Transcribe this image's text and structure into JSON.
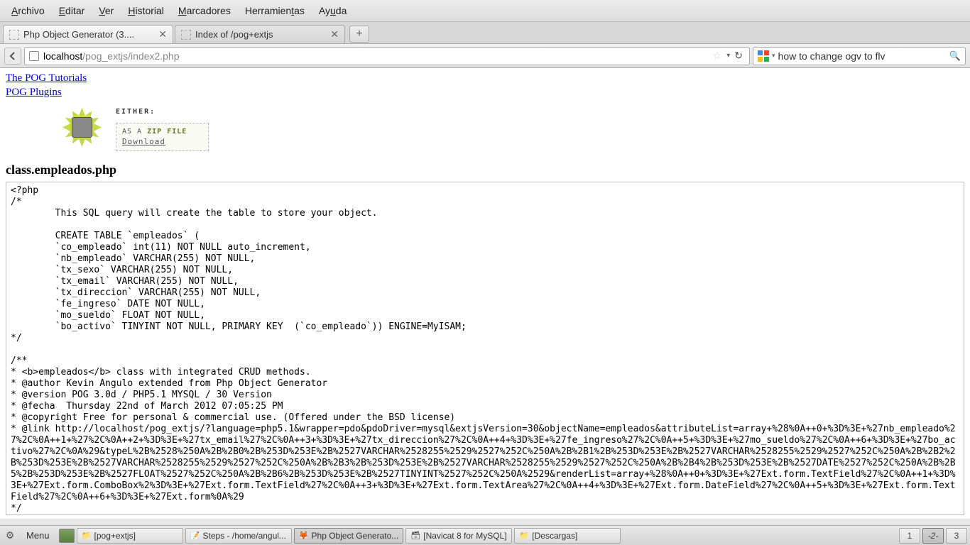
{
  "menubar": [
    "Archivo",
    "Editar",
    "Ver",
    "Historial",
    "Marcadores",
    "Herramientas",
    "Ayuda"
  ],
  "tabs": [
    {
      "title": "Php Object Generator (3....",
      "active": true
    },
    {
      "title": "Index of /pog+extjs",
      "active": false
    }
  ],
  "url": {
    "domain": "localhost",
    "path": "/pog_extjs/index2.php"
  },
  "search": {
    "query": "how to change ogv to flv"
  },
  "links": [
    "The POG Tutorials",
    "POG Plugins"
  ],
  "either": {
    "label": "EITHER:",
    "zip_prefix": "AS A ",
    "zip_suffix": "ZIP FILE",
    "download": "Download"
  },
  "class_title": "class.empleados.php",
  "code": "<?php\n/*\n\tThis SQL query will create the table to store your object.\n\n\tCREATE TABLE `empleados` (\n\t`co_empleado` int(11) NOT NULL auto_increment,\n\t`nb_empleado` VARCHAR(255) NOT NULL,\n\t`tx_sexo` VARCHAR(255) NOT NULL,\n\t`tx_email` VARCHAR(255) NOT NULL,\n\t`tx_direccion` VARCHAR(255) NOT NULL,\n\t`fe_ingreso` DATE NOT NULL,\n\t`mo_sueldo` FLOAT NOT NULL,\n\t`bo_activo` TINYINT NOT NULL, PRIMARY KEY  (`co_empleado`)) ENGINE=MyISAM;\n*/\n\n/**\n* <b>empleados</b> class with integrated CRUD methods.\n* @author Kevin Angulo extended from Php Object Generator\n* @version POG 3.0d / PHP5.1 MYSQL / 30 Version\n* @fecha  Thursday 22nd of March 2012 07:05:25 PM\n* @copyright Free for personal & commercial use. (Offered under the BSD license)\n* @link http://localhost/pog_extjs/?language=php5.1&wrapper=pdo&pdoDriver=mysql&extjsVersion=30&objectName=empleados&attributeList=array+%28%0A++0+%3D%3E+%27nb_empleado%27%2C%0A++1+%27%2C%0A++2+%3D%3E+%27tx_email%27%2C%0A++3+%3D%3E+%27tx_direccion%27%2C%0A++4+%3D%3E+%27fe_ingreso%27%2C%0A++5+%3D%3E+%27mo_sueldo%27%2C%0A++6+%3D%3E+%27bo_activo%27%2C%0A%29&typeL%2B%2528%250A%2B%2B0%2B%253D%253E%2B%2527VARCHAR%2528255%2529%2527%252C%250A%2B%2B1%2B%253D%253E%2B%2527VARCHAR%2528255%2529%2527%252C%250A%2B%2B2%2B%253D%253E%2B%2527VARCHAR%2528255%2529%2527%252C%250A%2B%2B3%2B%253D%253E%2B%2527VARCHAR%2528255%2529%2527%252C%250A%2B%2B4%2B%253D%253E%2B%2527DATE%2527%252C%250A%2B%2B5%2B%253D%253E%2B%2527FLOAT%2527%252C%250A%2B%2B6%2B%253D%253E%2B%2527TINYINT%2527%252C%250A%2529&renderList=array+%28%0A++0+%3D%3E+%27Ext.form.TextField%27%2C%0A++1+%3D%3E+%27Ext.form.ComboBox%2%3D%3E+%27Ext.form.TextField%27%2C%0A++3+%3D%3E+%27Ext.form.TextArea%27%2C%0A++4+%3D%3E+%27Ext.form.DateField%27%2C%0A++5+%3D%3E+%27Ext.form.TextField%27%2C%0A++6+%3D%3E+%27Ext.form%0A%29\n*/",
  "taskbar": {
    "menu": "Menu",
    "items": [
      {
        "label": "[pog+extjs]",
        "icon": "📁"
      },
      {
        "label": "Steps - /home/angul...",
        "icon": "📝"
      },
      {
        "label": "Php Object Generato...",
        "icon": "🦊",
        "active": true
      },
      {
        "label": "[Navicat 8 for MySQL]",
        "icon": "🗃"
      },
      {
        "label": "[Descargas]",
        "icon": "📁"
      }
    ],
    "workspaces": [
      "1",
      "-2-",
      "3"
    ]
  }
}
